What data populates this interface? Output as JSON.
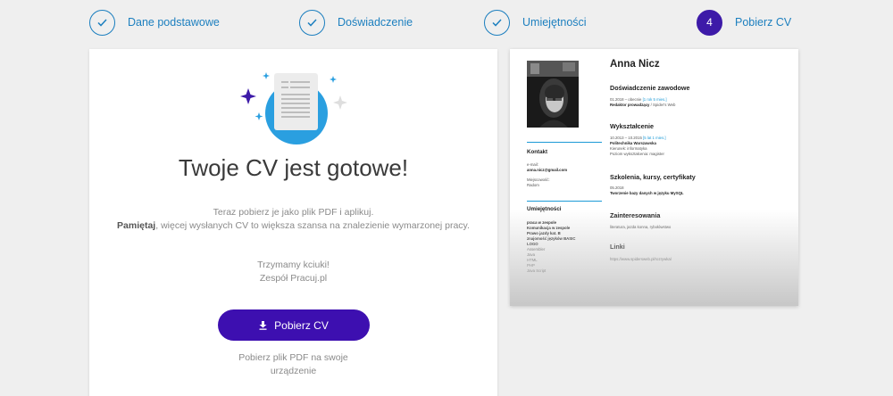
{
  "stepper": {
    "steps": [
      {
        "label": "Dane podstawowe",
        "state": "done"
      },
      {
        "label": "Doświadczenie",
        "state": "done"
      },
      {
        "label": "Umiejętności",
        "state": "done"
      },
      {
        "label": "Pobierz CV",
        "state": "active",
        "number": "4"
      }
    ]
  },
  "main": {
    "title": "Twoje CV jest gotowe!",
    "desc_line1": "Teraz pobierz je jako plik PDF i aplikuj.",
    "desc_bold": "Pamiętaj",
    "desc_rest": ", więcej wysłanych CV to większa szansa na znalezienie wymarzonej pracy.",
    "thanks_line1": "Trzymamy kciuki!",
    "thanks_line2": "Zespół Pracuj.pl",
    "download_label": "Pobierz CV",
    "sub_line1": "Pobierz plik PDF na swoje",
    "sub_line2": "urządzenie"
  },
  "cv": {
    "name": "Anna Nicz",
    "experience_heading": "Doświadczenie zawodowe",
    "exp_dates": "01.2018 – obecnie",
    "exp_duration": "[1 rok 5 mies.]",
    "exp_role": "Redaktor prowadzący",
    "exp_company": " / Spider's Web",
    "education_heading": "Wykształcenie",
    "edu_dates": "10.2013 – 10.2015",
    "edu_duration": "[5 lat 1 mies.]",
    "edu_school": "Politechnika Warszawska",
    "edu_field": "Kierunek: informatyka",
    "edu_level": "Poziom wykształcenia: magister",
    "training_heading": "Szkolenia, kursy, certyfikaty",
    "training_date": "05.2018",
    "training_name": "Tworzenie bazy danych w języku MySQL",
    "interests_heading": "Zainteresowania",
    "interests": "literatura, jazda konna, rybołówstwo",
    "links_heading": "Linki",
    "link": "https://www.spidersweb.pl/rozrywka/",
    "contact_heading": "Kontakt",
    "email_label": "e-mail:",
    "email": "anna.nicz@gmail.com",
    "city_label": "Miejscowość:",
    "city": "Radom",
    "skills_heading": "Umiejętności",
    "skills": [
      "praca w zespole",
      "Komunikacja w zespole",
      "Prawo jazdy kat. B",
      "znajomość języków BASIC",
      "LOGO",
      "Assembler",
      "Java",
      "HTML",
      "PHP",
      "Java Script"
    ]
  },
  "colors": {
    "accent_blue": "#1c7fbf",
    "primary_purple": "#3d0fb0"
  },
  "icons": {
    "step_done": "check-icon",
    "download": "download-icon"
  }
}
